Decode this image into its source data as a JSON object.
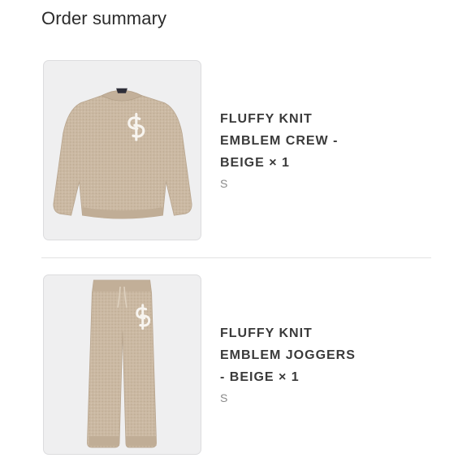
{
  "page": {
    "title": "Order summary"
  },
  "items": [
    {
      "name_lines": [
        "FLUFFY KNIT",
        "EMBLEM CREW -",
        "BEIGE × 1"
      ],
      "variant": "S",
      "image_icon": "crew-sweater-icon"
    },
    {
      "name_lines": [
        "FLUFFY KNIT",
        "EMBLEM JOGGERS",
        "- BEIGE × 1"
      ],
      "variant": "S",
      "image_icon": "joggers-icon"
    }
  ],
  "colors": {
    "thumb_background": "#efeff0",
    "garment_beige": "#cbb9a3",
    "emblem": "#f7f4ef",
    "divider": "#e3e3e3"
  }
}
